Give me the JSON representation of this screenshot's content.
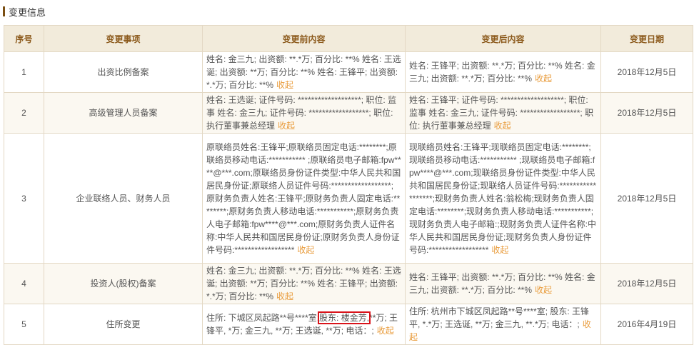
{
  "section": {
    "title": "变更信息"
  },
  "table": {
    "headers": {
      "index": "序号",
      "item": "变更事项",
      "before": "变更前内容",
      "after": "变更后内容",
      "date": "变更日期"
    },
    "collapse_label": "收起",
    "rows": [
      {
        "index": "1",
        "item": "出资比例备案",
        "before": "姓名: 金三九; 出资额: **.*万; 百分比: **% 姓名: 王选诞; 出资额: **万; 百分比: **% 姓名: 王锋平; 出资额: *.*万; 百分比: **%",
        "after": "姓名: 王锋平; 出资额: **.*万; 百分比: **% 姓名: 金三九; 出资额: **.*万; 百分比: **%",
        "date": "2018年12月5日"
      },
      {
        "index": "2",
        "item": "高级管理人员备案",
        "before": "姓名: 王选诞; 证件号码: *******************; 职位: 监事 姓名: 金三九; 证件号码: ******************; 职位: 执行董事兼总经理",
        "after": "姓名: 王锋平; 证件号码: *******************; 职位: 监事 姓名: 金三九; 证件号码: ******************; 职位: 执行董事兼总经理",
        "date": "2018年12月5日"
      },
      {
        "index": "3",
        "item": "企业联络人员、财务人员",
        "before": "原联络员姓名:王锋平;原联络员固定电话:********;原联络员移动电话:*********** ;原联络员电子邮箱:fpw****@***.com;原联络员身份证件类型:中华人民共和国居民身份证;原联络人员证件号码:******************;原财务负责人姓名:王锋平;原财务负责人固定电话:********;原财务负责人移动电话:***********;原财务负责人电子邮箱:fpw****@***.com;原财务负责人证件名称:中华人民共和国居民身份证;原财务负责人身份证件号码:******************",
        "after": "现联络员姓名:王锋平;现联络员固定电话:********;现联络员移动电话:*********** ;现联络员电子邮箱:fpw****@***.com;现联络员身份证件类型:中华人民共和国居民身份证;现联络人员证件号码:******************;现财务负责人姓名:翁松梅;现财务负责人固定电话:********;现财务负责人移动电话:***********;现财务负责人电子邮箱:;现财务负责人证件名称:中华人民共和国居民身份证;现财务负责人身份证件号码:******************",
        "date": "2018年12月5日"
      },
      {
        "index": "4",
        "item": "投资人(股权)备案",
        "before": "姓名: 金三九; 出资额: **.*万; 百分比: **% 姓名: 王选诞; 出资额: **万; 百分比: **% 姓名: 王锋平; 出资额: *.*万; 百分比: **%",
        "after": "姓名: 王锋平; 出资额: **.*万; 百分比: **% 姓名: 金三九; 出资额: **.*万; 百分比: **%",
        "date": "2018年12月5日"
      },
      {
        "index": "5",
        "item": "住所变更",
        "before_pre": "住所: 下城区凤起路**号****室;",
        "before_highlight": "股东: 楼金芳,",
        "before_post": "**万; 王锋平, *万; 金三九, **万; 王选诞, **万; 电话：;",
        "after": "住所: 杭州市下城区凤起路**号****室; 股东: 王锋平, *.*万; 王选诞, **万; 金三九, **.*万; 电话：;",
        "date": "2016年4月19日"
      }
    ]
  },
  "colors": {
    "header_bg": "#f2ebdb",
    "header_text": "#8c5a1c",
    "border": "#e3d8c4",
    "link": "#e99c3c",
    "highlight_box": "#d9141b",
    "section_bar": "#7a4e12"
  }
}
